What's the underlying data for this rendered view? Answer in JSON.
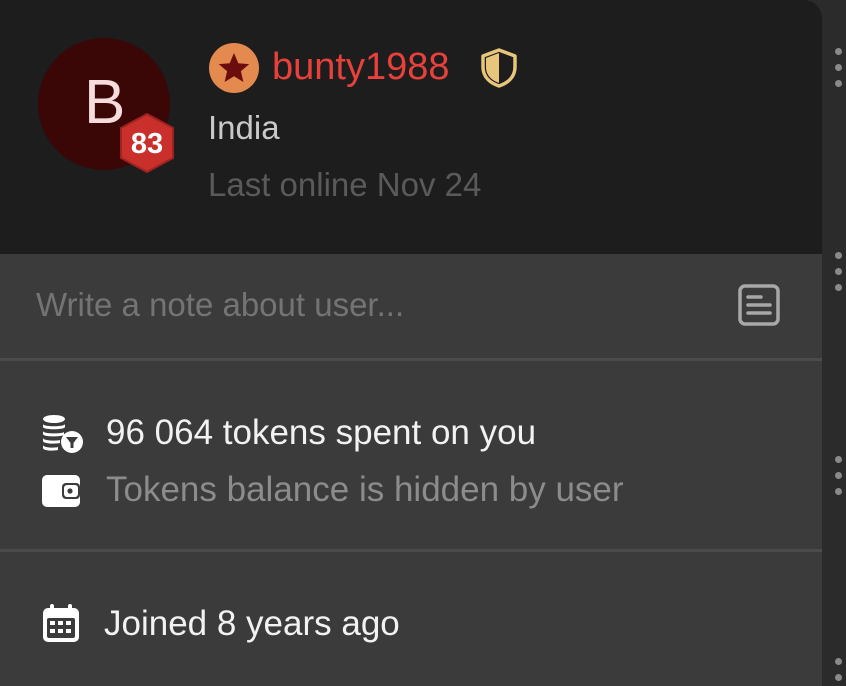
{
  "profile": {
    "avatar_letter": "B",
    "level": "83",
    "username": "bunty1988",
    "country": "India",
    "last_online": "Last online Nov 24",
    "username_color": "#e8413c"
  },
  "note": {
    "placeholder": "Write a note about user...",
    "value": ""
  },
  "tokens": {
    "spent_label": "96 064 tokens spent on you",
    "balance_label": "Tokens balance is hidden by user"
  },
  "joined": {
    "label": "Joined 8 years ago"
  },
  "icons": {
    "star": "star-badge-icon",
    "shield": "shield-icon",
    "note": "note-icon",
    "coins": "coins-filter-icon",
    "wallet": "wallet-icon",
    "calendar": "calendar-icon"
  }
}
